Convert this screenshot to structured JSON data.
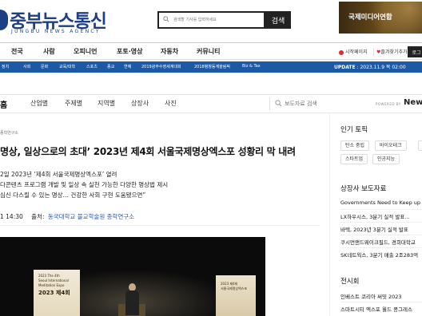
{
  "header": {
    "logo_text": "중부뉴스통신",
    "logo_sub": "JUNGBU NEWS AGENCY",
    "search_placeholder": "검색할 기사를 입력하세요",
    "search_button": "검색",
    "banner_text": "국제미디어연합"
  },
  "nav": {
    "items": [
      "전국",
      "사람",
      "오피니언",
      "포토·영상",
      "자동차",
      "커뮤니티"
    ],
    "util_links": [
      "시작페이지",
      "즐겨찾기추가",
      "로그인"
    ],
    "util_button": "로그"
  },
  "sub_nav": {
    "items": [
      "정치",
      "사회",
      "문화",
      "교육/대학",
      "스포츠",
      "종교",
      "연예",
      "2019광주수영세계대회",
      "2018평창동계올림픽",
      "Biz & Tax"
    ],
    "update_label": "UPDATE",
    "update_value": ": 2023.11.9 목 02:00"
  },
  "section_nav": {
    "home": "홈",
    "items": [
      "산업별",
      "주제별",
      "지역별",
      "상장사",
      "사진"
    ],
    "search_placeholder": "보도자료 검색",
    "powered_by": "POWERED BY",
    "brand": "News"
  },
  "article": {
    "category": "종학연구소",
    "title": "명상, 일상으로의 초대’ 2023년 제4회 서울국제명상엑스포 성황리 막 내려",
    "subtitles": [
      "2일 2023년 ‘제4회 서울국제명상엑스포’ 열려",
      "다콘텐츠 프로그램 개발 및 일상 속 실천 가능한 다양한 명상법 제시",
      "심신 다스릴 수 있는 명상… 건강한 사회 구현 도움됐으면”"
    ],
    "time": "1 14:30",
    "source_label": "출처:",
    "source": "동국대학교 불교학술원 종학연구소",
    "image": {
      "screen_line1": "2023 The 4th",
      "screen_line2": "Seoul International",
      "screen_line3": "Meditation Expo",
      "screen_big": "2023 제4회",
      "screen2_line1": "2023 제4회",
      "screen2_line2": "서울국제명상엑스포"
    }
  },
  "sidebar": {
    "hot_topics_title": "인기 토픽",
    "tags": [
      "탄소 중립",
      "바이오테크",
      "축제",
      "스타트업",
      "인공지능"
    ],
    "press_title": "상장사 보도자료",
    "press_items": [
      "Governments Need to Keep up",
      "LX하우시스, 3분기 실적 발표...",
      "바텍, 2023년 3분기 실적 발표",
      "쿠시먼앤드웨이크필드, 경희대학교",
      "SK네트웍스, 3분기 매출 2조283억"
    ],
    "exhibit_title": "전시회",
    "exhibit_items": [
      "인베스트 코리아 써밋 2023",
      "스마트시티 엑스포 월드 콩그레스"
    ]
  },
  "colors": {
    "brand_blue": "#1d3f86",
    "subnav_blue": "#1d5aa5",
    "link_blue": "#2a5bb8"
  }
}
